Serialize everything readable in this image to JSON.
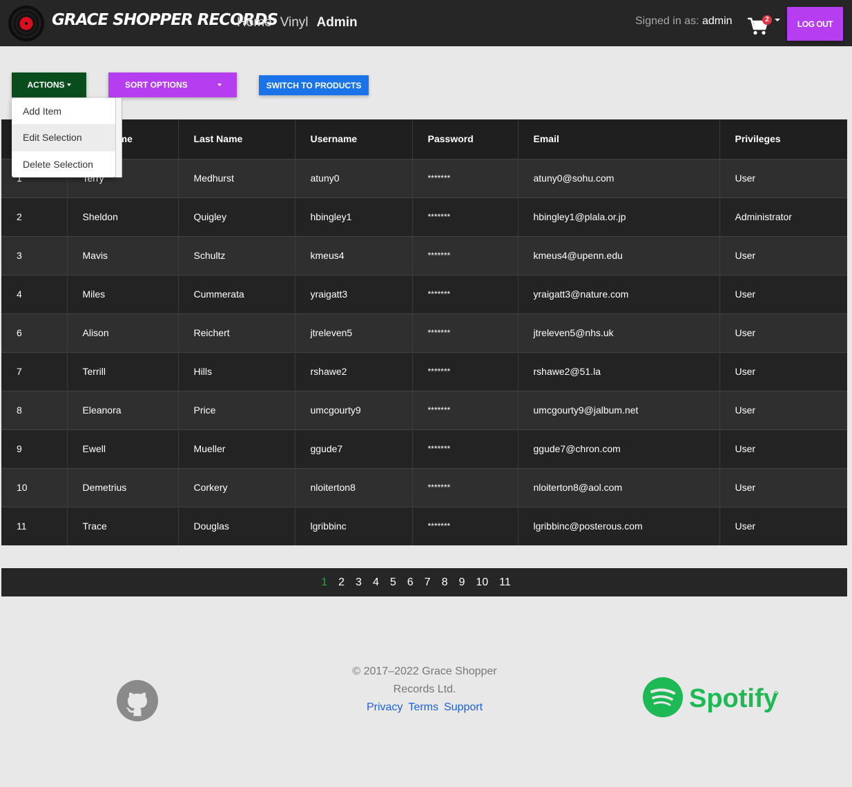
{
  "brand": {
    "name": "GRACE SHOPPER RECORDS"
  },
  "nav": {
    "links": [
      "Home",
      "Vinyl",
      "Admin"
    ]
  },
  "session": {
    "signed_label": "Signed in as: ",
    "username": "admin",
    "cart_count": "2",
    "logout_label": "LOG OUT"
  },
  "toolbar": {
    "actions_label": "ACTIONS",
    "sort_label": "SORT OPTIONS",
    "switch_label": "SWITCH TO PRODUCTS"
  },
  "actions_menu": [
    "Add Item",
    "Edit Selection",
    "Delete Selection"
  ],
  "table": {
    "headers": [
      "",
      "First Name",
      "Last Name",
      "Username",
      "Password",
      "Email",
      "Privileges"
    ],
    "rows": [
      [
        "1",
        "Terry",
        "Medhurst",
        "atuny0",
        "*******",
        "atuny0@sohu.com",
        "User"
      ],
      [
        "2",
        "Sheldon",
        "Quigley",
        "hbingley1",
        "*******",
        "hbingley1@plala.or.jp",
        "Administrator"
      ],
      [
        "3",
        "Mavis",
        "Schultz",
        "kmeus4",
        "*******",
        "kmeus4@upenn.edu",
        "User"
      ],
      [
        "4",
        "Miles",
        "Cummerata",
        "yraigatt3",
        "*******",
        "yraigatt3@nature.com",
        "User"
      ],
      [
        "6",
        "Alison",
        "Reichert",
        "jtreleven5",
        "*******",
        "jtreleven5@nhs.uk",
        "User"
      ],
      [
        "7",
        "Terrill",
        "Hills",
        "rshawe2",
        "*******",
        "rshawe2@51.la",
        "User"
      ],
      [
        "8",
        "Eleanora",
        "Price",
        "umcgourty9",
        "*******",
        "umcgourty9@jalbum.net",
        "User"
      ],
      [
        "9",
        "Ewell",
        "Mueller",
        "ggude7",
        "*******",
        "ggude7@chron.com",
        "User"
      ],
      [
        "10",
        "Demetrius",
        "Corkery",
        "nloiterton8",
        "*******",
        "nloiterton8@aol.com",
        "User"
      ],
      [
        "11",
        "Trace",
        "Douglas",
        "lgribbinc",
        "*******",
        "lgribbinc@posterous.com",
        "User"
      ]
    ]
  },
  "pagination": {
    "pages": [
      "1",
      "2",
      "3",
      "4",
      "5",
      "6",
      "7",
      "8",
      "9",
      "10",
      "11"
    ],
    "current": "1"
  },
  "footer": {
    "copyright": "© 2017–2022 Grace Shopper Records Ltd.",
    "links": [
      "Privacy",
      "Terms",
      "Support"
    ],
    "partner": "Spotify"
  },
  "colors": {
    "accent_purple": "#b63df0",
    "actions_green": "#0a4d1c",
    "switch_blue": "#1a73e8",
    "spotify_green": "#1db954"
  }
}
